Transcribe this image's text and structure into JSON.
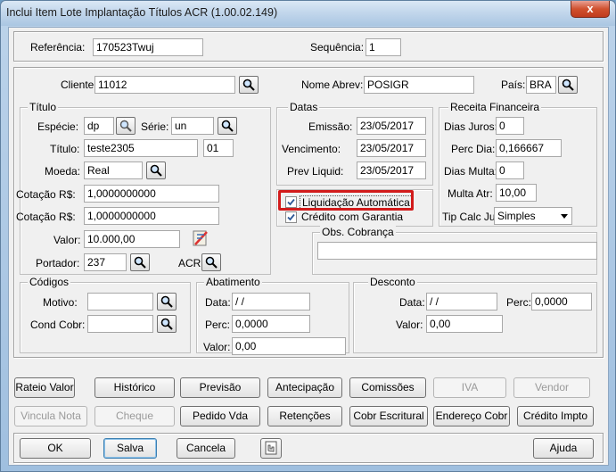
{
  "window": {
    "title": "Inclui Item Lote Implantação Títulos ACR (1.00.02.149)",
    "close_label": "x"
  },
  "top": {
    "referencia_label": "Referência:",
    "referencia_value": "170523Twuj",
    "sequencia_label": "Sequência:",
    "sequencia_value": "1"
  },
  "cliente": {
    "cliente_label": "Cliente:",
    "cliente_value": "11012",
    "nome_label": "Nome Abrev:",
    "nome_value": "POSIGR",
    "pais_label": "País:",
    "pais_value": "BRA"
  },
  "titulo": {
    "group": "Título",
    "especie_label": "Espécie:",
    "especie_value": "dp",
    "serie_label": "Série:",
    "serie_value": "un",
    "titulo_label": "Título:",
    "titulo_value": "teste2305",
    "parcela_value": "01",
    "moeda_label": "Moeda:",
    "moeda_value": "Real",
    "cotacao1_label": "Cotação R$:",
    "cotacao1_value": "1,0000000000",
    "cotacao2_label": "Cotação R$:",
    "cotacao2_value": "1,0000000000",
    "valor_label": "Valor:",
    "valor_value": "10.000,00",
    "portador_label": "Portador:",
    "portador_value": "237",
    "acr_label": "ACR"
  },
  "datas": {
    "group": "Datas",
    "emissao_label": "Emissão:",
    "emissao_value": "23/05/2017",
    "vencimento_label": "Vencimento:",
    "vencimento_value": "23/05/2017",
    "prev_label": "Prev Liquid:",
    "prev_value": "23/05/2017"
  },
  "checks": {
    "liquidacao_label": "Liquidação Automática",
    "credito_label": "Crédito com Garantia"
  },
  "receita": {
    "group": "Receita Financeira",
    "dias_juros_label": "Dias Juros:",
    "dias_juros_value": "0",
    "perc_dia_label": "Perc Dia:",
    "perc_dia_value": "0,166667",
    "dias_multa_label": "Dias Multa:",
    "dias_multa_value": "0",
    "multa_label": "Multa Atr:",
    "multa_value": "10,00",
    "tip_label": "Tip Calc Jur:",
    "tip_value": "Simples"
  },
  "obs": {
    "group": "Obs. Cobrança",
    "value": ""
  },
  "codigos": {
    "group": "Códigos",
    "motivo_label": "Motivo:",
    "cond_label": "Cond Cobr:"
  },
  "abatimento": {
    "group": "Abatimento",
    "data_label": "Data:",
    "data_value": " / /",
    "perc_label": "Perc:",
    "perc_value": "0,0000",
    "valor_label": "Valor:",
    "valor_value": "0,00"
  },
  "desconto": {
    "group": "Desconto",
    "data_label": "Data:",
    "data_value": " / /",
    "perc_label": "Perc:",
    "perc_value": "0,0000",
    "valor_label": "Valor:",
    "valor_value": "0,00"
  },
  "buttons_row1": [
    "Rateio Valor",
    "Histórico",
    "Previsão",
    "Antecipação",
    "Comissões",
    "IVA",
    "Vendor"
  ],
  "buttons_row2": [
    "Vincula Nota",
    "Cheque",
    "Pedido Vda",
    "Retenções",
    "Cobr Escritural",
    "Endereço Cobr",
    "Crédito Impto"
  ],
  "footer": {
    "ok": "OK",
    "salva": "Salva",
    "cancela": "Cancela",
    "ajuda": "Ajuda"
  },
  "colors": {
    "highlight": "#d21b1b",
    "titlebar": "#c3d7ec",
    "close": "#d0512f"
  }
}
